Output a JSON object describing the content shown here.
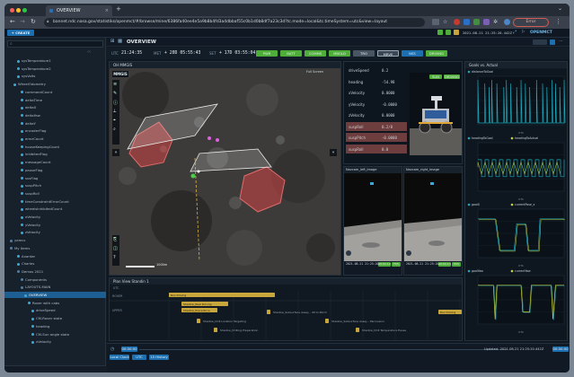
{
  "browser": {
    "tab_title": "OVERVIEW",
    "url": "bannet.ndc.nasa.gov/statistiks/openmct/#/browse/mine/6386fa40ee4e5a9b8b4fd3a4dbbaf55c0b1d0b8df7a23c3d?tc.mode=local&tc.timeSystem=utc&view=layout",
    "profile_label": "Error"
  },
  "app": {
    "create_label": "+ CREATE",
    "page_title": "OVERVIEW",
    "brand": "OPENMCT",
    "clock_text": "2021-08-21 21:25:20.442Z",
    "status_text": "Connected"
  },
  "colors": {
    "accent": "#1d6fb0",
    "green": "#4fae3a",
    "teal": "#1aa5b8",
    "yellow": "#c9a63c",
    "red": "#d04545"
  },
  "sidebar": {
    "search_placeholder": "",
    "items": [
      {
        "label": "sysTemperature1"
      },
      {
        "label": "sysTemperature2"
      },
      {
        "label": "sysVolts"
      },
      {
        "label": "WheelOdometry"
      },
      {
        "label": "commandCount"
      },
      {
        "label": "deltaTime"
      },
      {
        "label": "deltaX"
      },
      {
        "label": "deltaYaw"
      },
      {
        "label": "deltaY"
      },
      {
        "label": "encoderFlag"
      },
      {
        "label": "errorCount"
      },
      {
        "label": "houseKeepingCount"
      },
      {
        "label": "inhibitedFlag"
      },
      {
        "label": "messageCount"
      },
      {
        "label": "pauseFlag"
      },
      {
        "label": "susFlag"
      },
      {
        "label": "suspPitch"
      },
      {
        "label": "suspRoll"
      },
      {
        "label": "timeConstraintErrorCount"
      },
      {
        "label": "wheelsInhibitedCount"
      },
      {
        "label": "xVelocity"
      },
      {
        "label": "yVelocity"
      },
      {
        "label": "zVelocity"
      },
      {
        "label": "yamcs"
      },
      {
        "label": "My Items"
      },
      {
        "label": "Anantar"
      },
      {
        "label": "Charles"
      },
      {
        "label": "Demos 2021"
      },
      {
        "label": "Components"
      },
      {
        "label": "LAYOUTS-MAIN"
      },
      {
        "label": "OVERVIEW"
      },
      {
        "label": "Rover with cabs"
      },
      {
        "label": "driveSpeed"
      },
      {
        "label": "CM-Rover state"
      },
      {
        "label": "heading"
      },
      {
        "label": "CM-Sun angle state"
      },
      {
        "label": "xVelocity"
      }
    ]
  },
  "toolbar": {
    "utc_label": "UTC",
    "utc_value": "21:24:35",
    "met_label": "MET",
    "met_value": "+ 20D 05:55:43",
    "set_label": "SET",
    "set_value": "+ 17D 03:55:04",
    "buttons": [
      {
        "label": "PWR"
      },
      {
        "label": "BATT"
      },
      {
        "label": "COMMS"
      },
      {
        "label": "MBOLD"
      },
      {
        "label": "TRO"
      },
      {
        "label": "MRVE"
      },
      {
        "label": "NSS"
      },
      {
        "label": "DRIVING"
      }
    ]
  },
  "map": {
    "title": "OH MMGIS",
    "logo": "MMGIS",
    "scale_label": "1000m",
    "fullscreen_label": "Full Screen"
  },
  "telemetry": {
    "rows": [
      {
        "label": "driveSpeed",
        "value": "0.2"
      },
      {
        "label": "heading",
        "value": "-54.98"
      },
      {
        "label": "xVelocity",
        "value": "0.0000"
      },
      {
        "label": "yVelocity",
        "value": "-0.0000"
      },
      {
        "label": "zVelocity",
        "value": "0.0000"
      },
      {
        "label": "suspRoll",
        "value": "0.2/8"
      },
      {
        "label": "suspPitch",
        "value": "-0.0000"
      },
      {
        "label": "suspRoll",
        "value": "0.0"
      }
    ],
    "rover_button_1": "SUN",
    "rover_button_2": "DRIVING"
  },
  "cams": {
    "left_title": "Navcam_left_image",
    "right_title": "Navcam_right_image",
    "left_time": "2021-08-21 21:25:20.442",
    "right_time": "2021-08-21 21:25:20.4422",
    "left_badge_1": "00:01:12",
    "left_badge_2": "FCS",
    "right_badge_1": "00:01:13",
    "right_badge_2": "PCS"
  },
  "timeline": {
    "title": "Plan View Standin 1",
    "x_ticks": [
      "UTC",
      "",
      "",
      "",
      "",
      "",
      "",
      "",
      "",
      "",
      ""
    ],
    "rows": [
      {
        "label": "ROVER"
      },
      {
        "label": "UPPER"
      }
    ],
    "bars": [
      {
        "label": "Rov Driving"
      },
      {
        "label": "Shadow_Real Driving"
      },
      {
        "label": "Shadow_Precedince"
      },
      {
        "label": "Shadow_Subsurface Assay - 40 to 60cm"
      },
      {
        "label": "Shadow_Drill Location Targeting"
      },
      {
        "label": "Shadow_Subsurface Assay - Percussion"
      },
      {
        "label": "Shadow_Drilling Preparation"
      },
      {
        "label": "Shadow_Drill Temperature Pause"
      },
      {
        "label": "Rov Driving"
      },
      {
        "label": "Rov Driving"
      }
    ]
  },
  "bottom": {
    "local_clock": "Local Clock",
    "utc": "UTC",
    "history": "15 History",
    "t_start": "00:00:00",
    "t_end": "00:00:00",
    "updated": "Updated: 2021-08-21 21:25:20.442Z"
  },
  "plots": {
    "title": "Goals vs. Actual",
    "charts": [
      {
        "legend": "distanceToGoal"
      },
      {
        "legend": "headingToGoal",
        "legend2": "headingToActual"
      },
      {
        "legend": "goalX",
        "legend2": "currentPose_x"
      },
      {
        "legend": "goalYaw",
        "legend2": "currentYaw"
      }
    ],
    "x_ticks": [
      "",
      "",
      "",
      "",
      ""
    ],
    "x_label": "UTC"
  }
}
